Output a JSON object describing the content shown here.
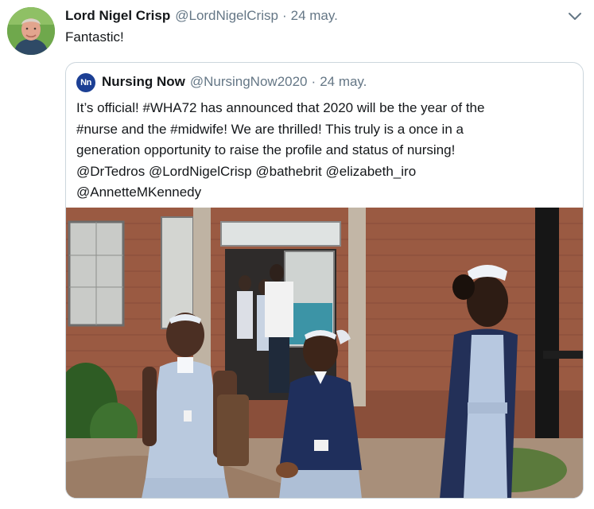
{
  "tweet": {
    "author_name": "Lord Nigel Crisp",
    "author_handle": "@LordNigelCrisp",
    "separator": "·",
    "date": "24 may.",
    "text": "Fantastic!"
  },
  "quoted": {
    "logo_text": "Nn",
    "author_name": "Nursing Now",
    "author_handle": "@NursingNow2020",
    "separator": "·",
    "date": "24 may.",
    "lines": [
      "It’s official! #WHA72 has announced that 2020 will be the year of the",
      "#nurse and the #midwife! We are thrilled! This truly is a once in a",
      "generation opportunity to raise the profile and status of nursing!",
      "@DrTedros @LordNigelCrisp @bathebrit @elizabeth_iro",
      "@AnnetteMKennedy"
    ]
  },
  "icons": {
    "menu": "chevron-down-icon",
    "avatar": "profile-photo",
    "media": "nurses-photo"
  },
  "colors": {
    "text": "#14171a",
    "muted": "#657786",
    "border": "#ccd6dd",
    "logo": "#1c3f94"
  }
}
